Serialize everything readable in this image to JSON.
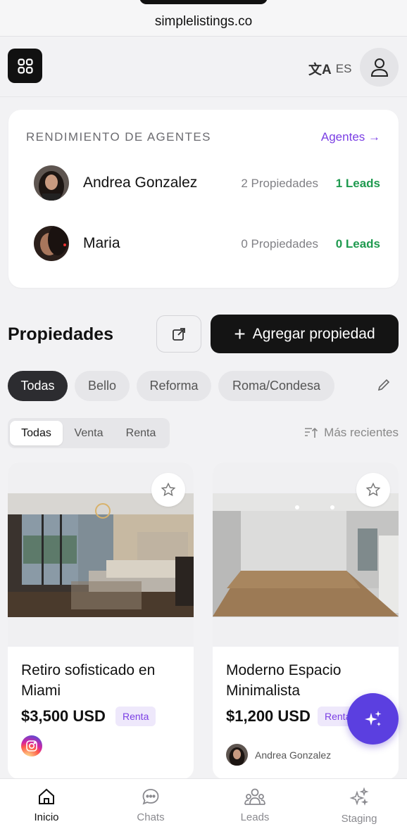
{
  "browser": {
    "url": "simplelistings.co"
  },
  "header": {
    "lang_icon": "translate-icon",
    "lang": "ES"
  },
  "agents": {
    "title": "RENDIMIENTO DE AGENTES",
    "link": "Agentes →",
    "rows": [
      {
        "name": "Andrea Gonzalez",
        "props": "2 Propiedades",
        "leads": "1 Leads"
      },
      {
        "name": "Maria",
        "props": "0 Propiedades",
        "leads": "0 Leads"
      }
    ]
  },
  "properties": {
    "title": "Propiedades",
    "add_label": "Agregar propiedad",
    "chips": [
      "Todas",
      "Bello",
      "Reforma",
      "Roma/Condesa"
    ],
    "segments": [
      "Todas",
      "Venta",
      "Renta"
    ],
    "sort_label": "Más recientes",
    "cards": [
      {
        "title": "Retiro sofisticado en Miami",
        "price": "$3,500 USD",
        "badge": "Renta"
      },
      {
        "title": "Moderno Espacio Minimalista",
        "price": "$1,200 USD",
        "badge": "Renta",
        "owner": "Andrea Gonzalez"
      }
    ]
  },
  "nav": {
    "items": [
      {
        "label": "Inicio",
        "icon": "home-icon"
      },
      {
        "label": "Chats",
        "icon": "chat-icon"
      },
      {
        "label": "Leads",
        "icon": "users-icon"
      },
      {
        "label": "Staging",
        "icon": "sparkles-icon"
      }
    ]
  },
  "colors": {
    "accent": "#7b3fe4",
    "leads": "#1f9a4f",
    "fab": "#5b3fe0",
    "dark": "#141414"
  }
}
